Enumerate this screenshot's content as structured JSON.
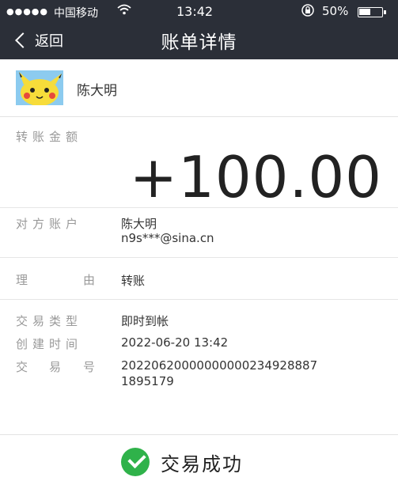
{
  "status_bar": {
    "signal": "●●●●●",
    "carrier": "中国移动",
    "wifi_icon": "wifi-icon",
    "time": "13:42",
    "lock_icon": "orientation-lock-icon",
    "battery_percent_text": "50%",
    "battery_level": 0.5
  },
  "nav": {
    "back_label": "返回",
    "title": "账单详情"
  },
  "user": {
    "avatar_icon": "pikachu-avatar",
    "name": "陈大明"
  },
  "amount": {
    "label": "转账金额",
    "value": "+100.00"
  },
  "details": {
    "counterparty_label": "对方账户",
    "counterparty_name": "陈大明",
    "counterparty_account": "n9s***@sina.cn",
    "reason_label_1": "理",
    "reason_label_2": "由",
    "reason_value": "转账",
    "trade_type_label": "交易类型",
    "trade_type_value": "即时到帐",
    "create_time_label": "创建时间",
    "create_time_value": "2022-06-20 13:42",
    "trade_no_label_1": "交",
    "trade_no_label_2": "易",
    "trade_no_label_3": "号",
    "trade_no_line1": "20220620000000000234928887",
    "trade_no_line2": "1895179"
  },
  "footer": {
    "status_icon": "success-check-icon",
    "status_text": "交易成功"
  },
  "colors": {
    "header_bg": "#2b2f38",
    "success_green": "#2fb24a"
  }
}
